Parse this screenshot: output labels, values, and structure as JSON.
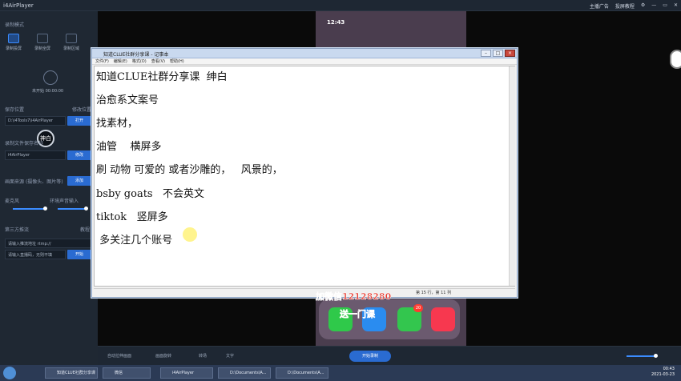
{
  "window": {
    "title": "i4AirPlayer",
    "right_links": [
      "主播广告",
      "投屏教程"
    ]
  },
  "sidebar": {
    "record_mode_label": "录制模式",
    "modes": [
      "录制投屏",
      "录制全屏",
      "录制区域"
    ],
    "rec_status": "未开始",
    "rec_time": "00:00:00",
    "save_location_label": "保存位置",
    "save_location_right": "修改位置",
    "save_path": "D:\\i4Tools7\\i4AirPlayer",
    "open_btn": "打开",
    "filename_label": "录制文件保存名称",
    "filename_value": "i4AirPlayer",
    "modify_btn": "修改",
    "source_label": "画面来源",
    "source_hint": "(摄像头、图片等)",
    "add_btn": "添加",
    "mic_label": "麦克风",
    "ambient_label": "环境声音输入",
    "third_party_label": "第三方推流",
    "third_party_right": "教程",
    "push_url_placeholder": "请输入推流地址 rtmp://",
    "push_key_placeholder": "请输入直播码，无则不填",
    "start_push_btn": "开始",
    "badge_text": "神白"
  },
  "notepad": {
    "title": "知道CLUE社群分享课 - 记事本",
    "menu": [
      "文件(F)",
      "编辑(E)",
      "格式(O)",
      "查看(V)",
      "帮助(H)"
    ],
    "lines": [
      "知道CLUE社群分享课  绅白",
      "治愈系文案号",
      "找素材，",
      "油管    横屏多",
      "刷 动物 可爱的 或者沙雕的，   风景的，",
      "bsby goats   不会英文",
      "tiktok   竖屏多",
      " 多关注几个账号"
    ],
    "status": "第 15 行，第 11 列"
  },
  "phone": {
    "time": "12:43",
    "badge_count": "20"
  },
  "watermark": {
    "line1": "加微信12128280",
    "line2": "送一门课"
  },
  "bottom": {
    "items": [
      "自动拉伸画面",
      "画面旋转",
      "转场",
      "文字"
    ],
    "start_btn": "开始录制"
  },
  "taskbar": {
    "tasks": [
      "知道CLUE社群分享课",
      "微信",
      "i4AirPlayer",
      "D:\\Documents\\A...",
      "D:\\Documents\\A..."
    ],
    "time": "00:43",
    "date": "2021-03-23"
  },
  "colors": {
    "accent": "#2a6bd1",
    "sidebar": "#1f2833",
    "watermark": "#e73a2f"
  }
}
